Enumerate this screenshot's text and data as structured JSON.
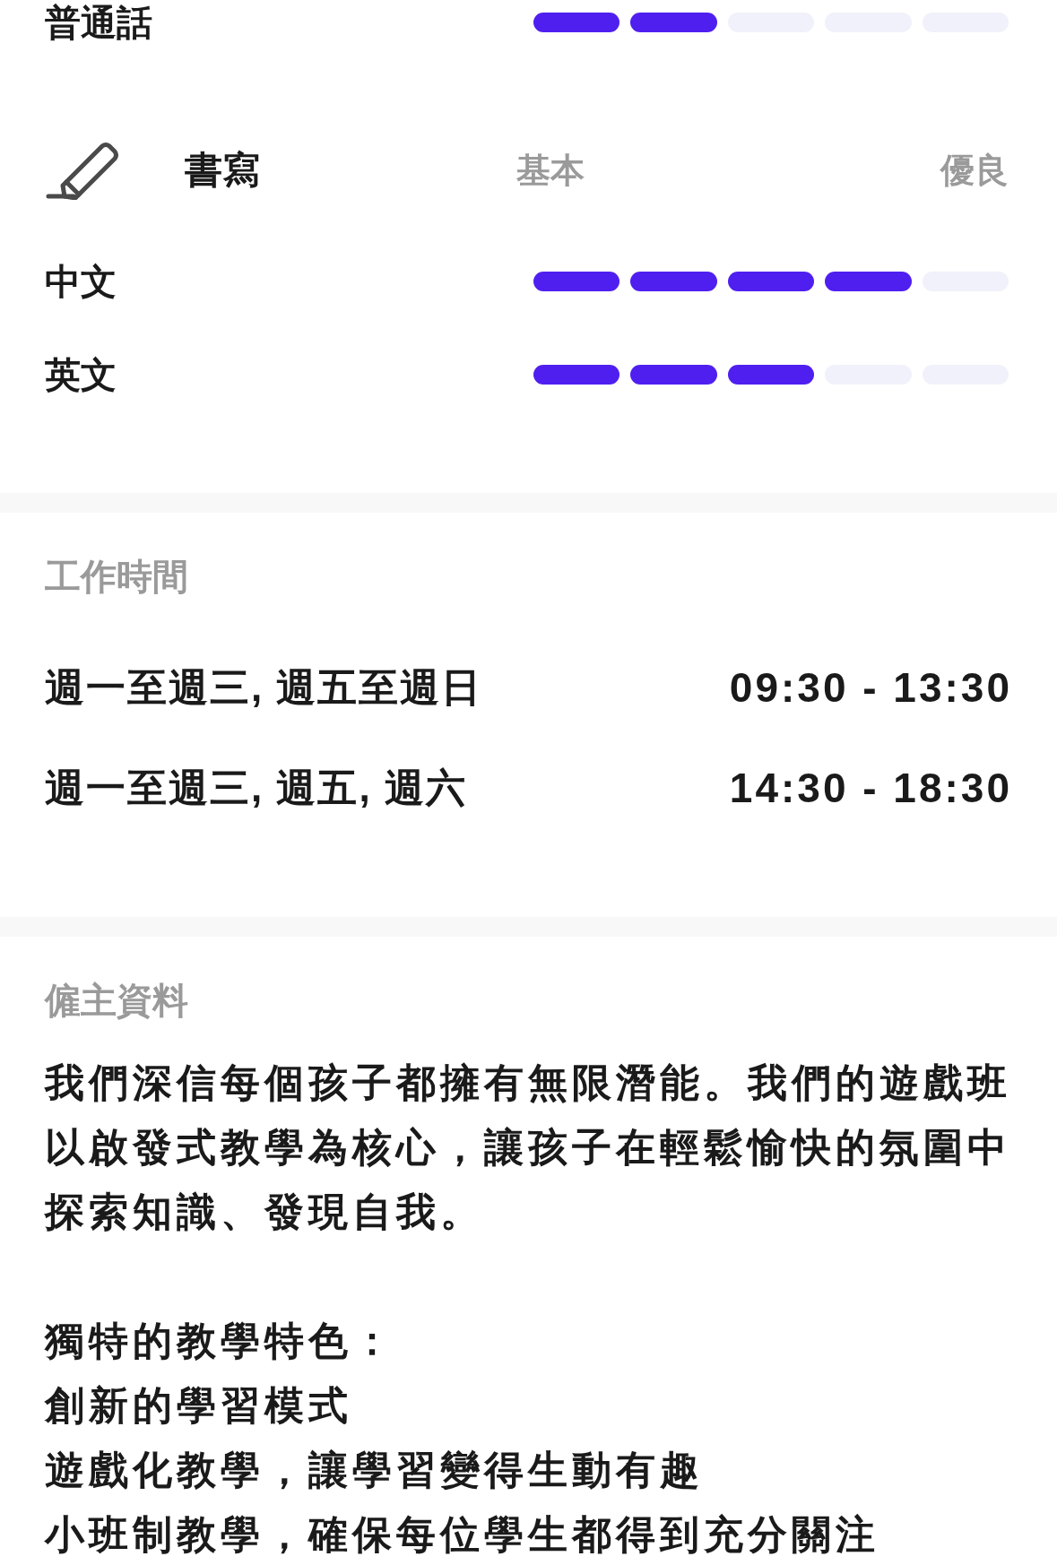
{
  "languages_tail": [
    {
      "name": "普通話",
      "level": 0.4
    }
  ],
  "writing": {
    "title": "書寫",
    "scale_low": "基本",
    "scale_high": "優良",
    "items": [
      {
        "name": "中文",
        "level": 0.8
      },
      {
        "name": "英文",
        "level": 0.6
      }
    ]
  },
  "working_hours": {
    "title": "工作時間",
    "rows": [
      {
        "days": "週一至週三, 週五至週日",
        "time": "09:30 - 13:30"
      },
      {
        "days": "週一至週三, 週五, 週六",
        "time": "14:30 - 18:30"
      }
    ]
  },
  "employer": {
    "title": "僱主資料",
    "intro": "我們深信每個孩子都擁有無限潛能。我們的遊戲班以啟發式教學為核心，讓孩子在輕鬆愉快的氛圍中探索知識、發現自我。",
    "lines": [
      "獨特的教學特色：",
      "創新的學習模式",
      "遊戲化教學，讓學習變得生動有趣",
      "小班制教學，確保每位學生都得到充分關注"
    ]
  }
}
